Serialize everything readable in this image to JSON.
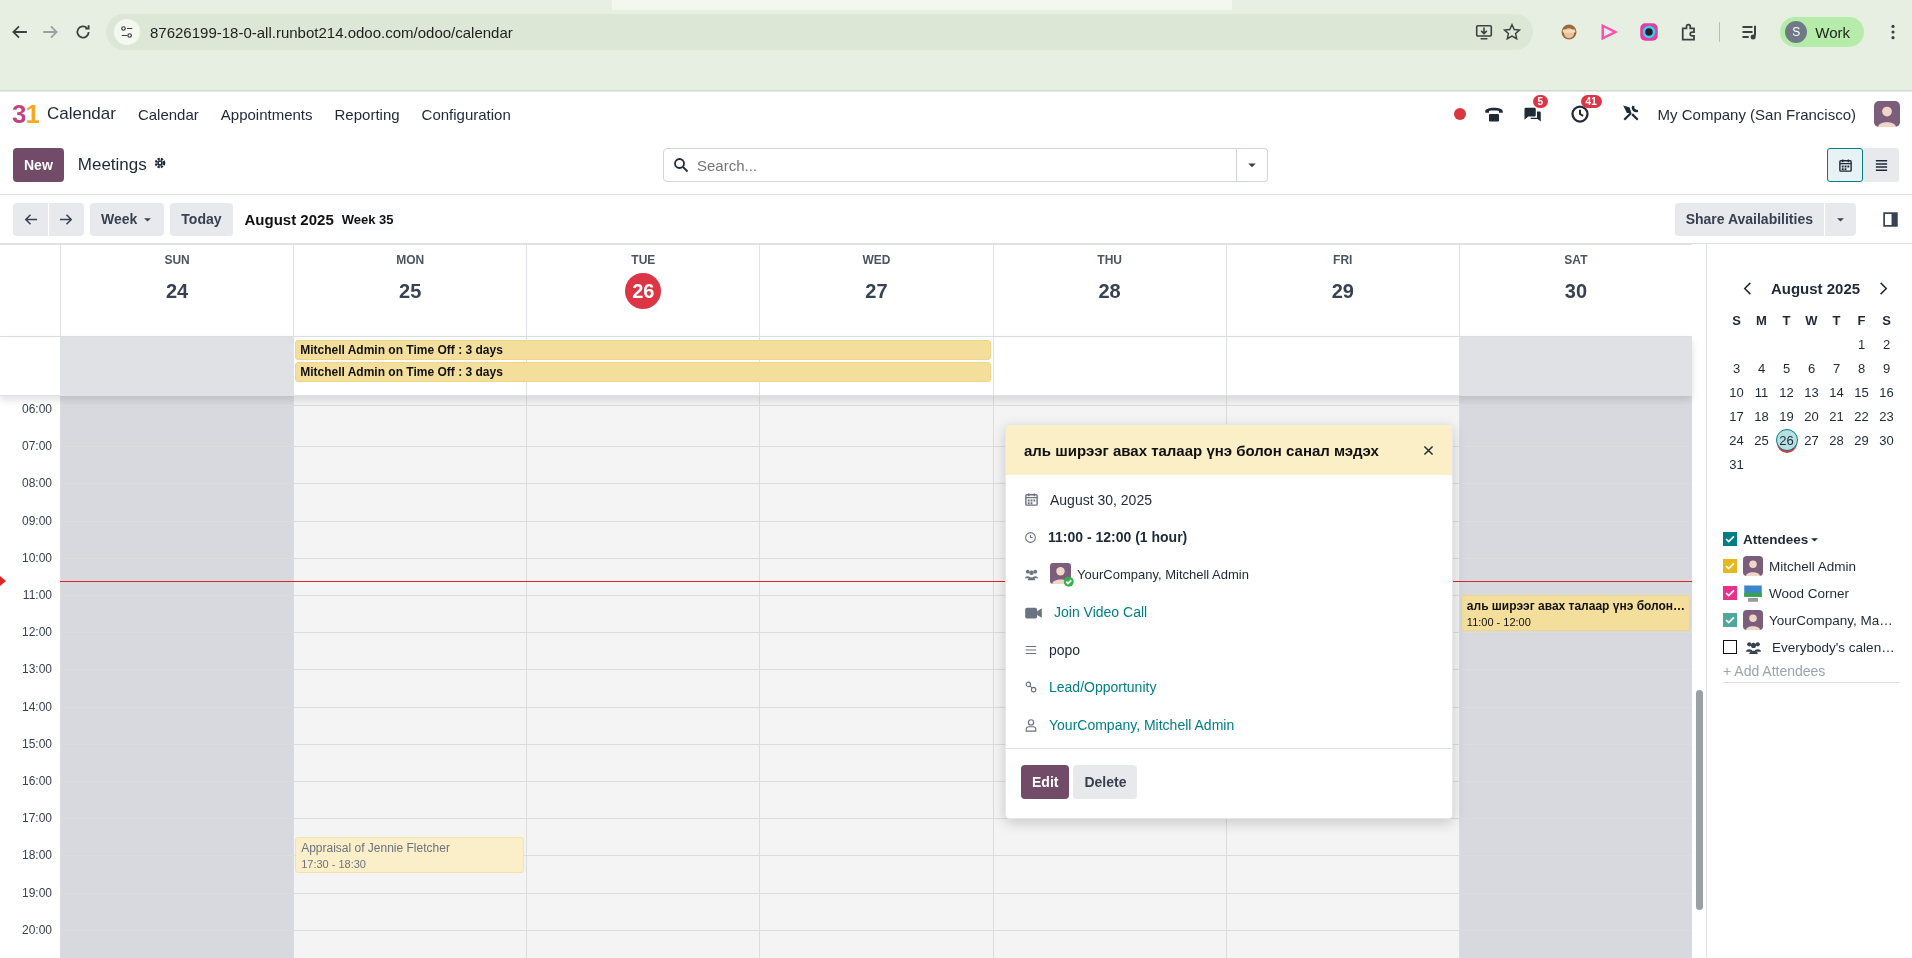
{
  "browser": {
    "url": "87626199-18-0-all.runbot214.odoo.com/odoo/calendar",
    "profile_initial": "S",
    "profile_name": "Work"
  },
  "navbar": {
    "logo": "31",
    "app_name": "Calendar",
    "menu": [
      "Calendar",
      "Appointments",
      "Reporting",
      "Configuration"
    ],
    "chat_count": "5",
    "activity_count": "41",
    "company": "My Company (San Francisco)"
  },
  "control_panel": {
    "new_button": "New",
    "title": "Meetings",
    "search_placeholder": "Search...",
    "views": [
      {
        "kind": "calendar",
        "selected": true
      },
      {
        "kind": "list",
        "selected": false
      }
    ]
  },
  "toolbar": {
    "scale": "Week",
    "today": "Today",
    "period": "August 2025",
    "week": "Week 35",
    "share": "Share Availabilities"
  },
  "days": [
    {
      "weekday": "SUN",
      "day": "24",
      "today": false,
      "weekend": true
    },
    {
      "weekday": "MON",
      "day": "25",
      "today": false,
      "weekend": false
    },
    {
      "weekday": "TUE",
      "day": "26",
      "today": true,
      "weekend": false
    },
    {
      "weekday": "WED",
      "day": "27",
      "today": false,
      "weekend": false
    },
    {
      "weekday": "THU",
      "day": "28",
      "today": false,
      "weekend": false
    },
    {
      "weekday": "FRI",
      "day": "29",
      "today": false,
      "weekend": false
    },
    {
      "weekday": "SAT",
      "day": "30",
      "today": false,
      "weekend": true
    }
  ],
  "all_day_events": [
    {
      "title": "Mitchell Admin on Time Off : 3 days"
    },
    {
      "title": "Mitchell Admin on Time Off : 3 days"
    }
  ],
  "hours": [
    "06:00",
    "07:00",
    "08:00",
    "09:00",
    "10:00",
    "11:00",
    "12:00",
    "13:00",
    "14:00",
    "15:00",
    "16:00",
    "17:00",
    "18:00",
    "19:00",
    "20:00"
  ],
  "events": [
    {
      "title": "Appraisal of Jennie Fletcher",
      "time": "17:30 - 18:30",
      "faded": true
    },
    {
      "title": "аль ширээг авах талаар үнэ болон…",
      "time": "11:00 - 12:00",
      "faded": false
    }
  ],
  "popup": {
    "title": "аль ширээг авах талаар үнэ болон санал мэдэх",
    "date": "August 30, 2025",
    "time": "11:00 - 12:00 (1 hour)",
    "attendees": "YourCompany, Mitchell Admin",
    "video_link": "Join Video Call",
    "description": "popo",
    "related": "Lead/Opportunity",
    "organizer": "YourCompany, Mitchell Admin",
    "buttons": [
      {
        "kind": "primary",
        "label": "Edit"
      },
      {
        "kind": "secondary",
        "label": "Delete"
      }
    ]
  },
  "sidebar": {
    "month": "August 2025",
    "weekdays": [
      "S",
      "M",
      "T",
      "W",
      "T",
      "F",
      "S"
    ],
    "weeks": [
      [
        {
          "d": "1",
          "selected": false
        },
        {
          "d": "2",
          "selected": false
        }
      ],
      [
        {
          "d": "3",
          "selected": false
        },
        {
          "d": "4",
          "selected": false
        },
        {
          "d": "5",
          "selected": false
        },
        {
          "d": "6",
          "selected": false
        },
        {
          "d": "7",
          "selected": false
        },
        {
          "d": "8",
          "selected": false
        },
        {
          "d": "9",
          "selected": false
        }
      ],
      [
        {
          "d": "10",
          "selected": false
        },
        {
          "d": "11",
          "selected": false
        },
        {
          "d": "12",
          "selected": false
        },
        {
          "d": "13",
          "selected": false
        },
        {
          "d": "14",
          "selected": false
        },
        {
          "d": "15",
          "selected": false
        },
        {
          "d": "16",
          "selected": false
        }
      ],
      [
        {
          "d": "17",
          "selected": false
        },
        {
          "d": "18",
          "selected": false
        },
        {
          "d": "19",
          "selected": false
        },
        {
          "d": "20",
          "selected": false
        },
        {
          "d": "21",
          "selected": false
        },
        {
          "d": "22",
          "selected": false
        },
        {
          "d": "23",
          "selected": false
        }
      ],
      [
        {
          "d": "24",
          "selected": false
        },
        {
          "d": "25",
          "selected": false
        },
        {
          "d": "26",
          "selected": true
        },
        {
          "d": "27",
          "selected": false
        },
        {
          "d": "28",
          "selected": false
        },
        {
          "d": "29",
          "selected": false
        },
        {
          "d": "30",
          "selected": false
        }
      ],
      [
        {
          "d": "31",
          "selected": false
        }
      ]
    ],
    "filter_section": {
      "label": "Attendees",
      "checked": true
    },
    "filters": [
      {
        "name": "Mitchell Admin",
        "checked": true,
        "color": "#e6b81c",
        "kind": "person"
      },
      {
        "name": "Wood Corner",
        "checked": true,
        "color": "#e8318a",
        "kind": "landscape"
      },
      {
        "name": "YourCompany, Ma…",
        "checked": true,
        "color": "#4ea99c",
        "kind": "person"
      },
      {
        "name": "Everybody's calen…",
        "checked": false,
        "kind": "group"
      }
    ],
    "add_label": "+ Add Attendees"
  }
}
